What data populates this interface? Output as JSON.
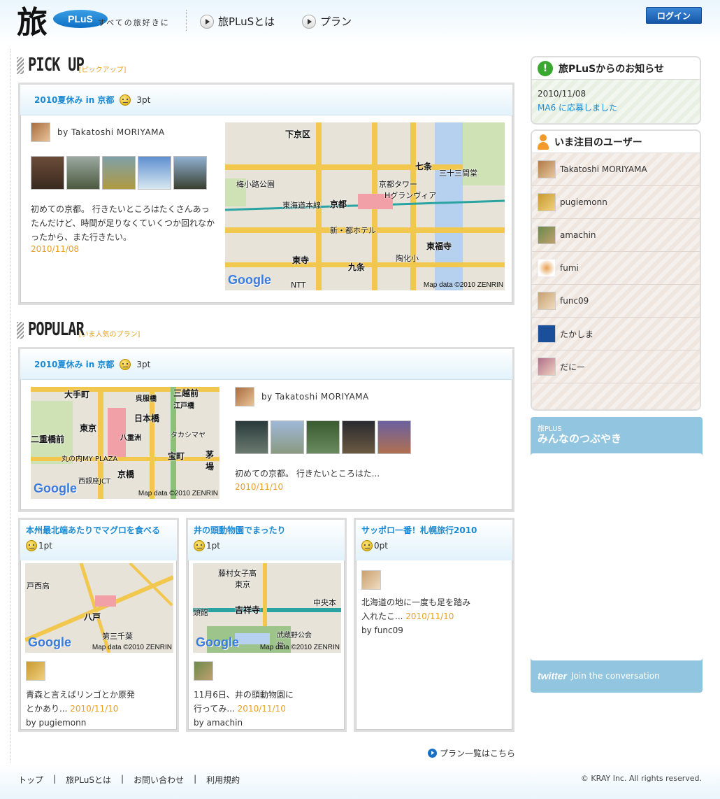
{
  "header": {
    "logo_kanji": "旅",
    "logo_badge": "PLuS",
    "tagline": "すべての旅好きに",
    "nav": [
      {
        "label": "旅PLuSとは"
      },
      {
        "label": "プラン"
      }
    ],
    "login_label": "ログイン"
  },
  "pickup": {
    "heading": "PICK UP",
    "subheading": "[ピックアップ]",
    "plan_title": "2010夏休み in 京都",
    "points": "3pt",
    "author": "by Takatoshi MORIYAMA",
    "description": "初めての京都。 行きたいところはたくさんあったんだけど、時間が足りなくていくつか回れなかったから、また行きたい。",
    "date": "2010/11/08",
    "map": {
      "credit": "Map data ©2010 ZENRIN",
      "powered": "Google",
      "labels": [
        "下京区",
        "七条",
        "京都",
        "東寺",
        "東福寺",
        "九条",
        "東海道本線",
        "梅小路公園",
        "京都タワー",
        "新・都ホテル",
        "三十三間堂",
        "Hグランヴィア",
        "NTT",
        "陶化小"
      ]
    }
  },
  "popular": {
    "heading": "POPULAR",
    "subheading": "[いま人気のプラン]",
    "plan_title": "2010夏休み in 京都",
    "points": "3pt",
    "author": "by Takatoshi MORIYAMA",
    "description": "初めての京都。 行きたいところはた...",
    "date": "2010/11/10",
    "map": {
      "credit": "Map data ©2010 ZENRIN",
      "powered": "Google",
      "labels": [
        "大手町",
        "三越前",
        "日本橋",
        "東京",
        "二重橋前",
        "八重洲",
        "京橋",
        "宝町",
        "茅場",
        "丸の内MY PLAZA",
        "西銀座JCT",
        "呉服橋",
        "江戸橋",
        "タカシマヤ"
      ]
    }
  },
  "cards": [
    {
      "title": "本州最北端あたりでマグロを食べる",
      "points": "1pt",
      "description_1": "青森と言えばリンゴとか原発",
      "description_2": "とかあり...",
      "date": "2010/11/10",
      "author": "by pugiemonn",
      "map": {
        "credit": "Map data ©2010 ZENRIN",
        "powered": "Google",
        "labels": [
          "八戸",
          "戸西高",
          "第三千葉"
        ]
      }
    },
    {
      "title": "井の頭動物園でまったり",
      "points": "1pt",
      "description_1": "11月6日、井の頭動物園に",
      "description_2": "行ってみ...",
      "date": "2010/11/10",
      "author": "by amachin",
      "map": {
        "credit": "Map data ©2010 ZENRIN",
        "powered": "Google",
        "labels": [
          "吉祥寺",
          "藤村女子高",
          "東京",
          "頭館",
          "中央本",
          "武蔵野公会堂"
        ]
      }
    },
    {
      "title": "サッポロ一番！札幌旅行2010",
      "points": "0pt",
      "description_1": "北海道の地に一度も足を踏み",
      "description_2": "入れたこ...",
      "date": "2010/11/10",
      "author": "by func09"
    }
  ],
  "more_link": "プラン一覧はこちら",
  "notice": {
    "title": "旅PLuSからのお知らせ",
    "date": "2010/11/08",
    "text": "MA6 に応募しました"
  },
  "users": {
    "title": "いま注目のユーザー",
    "items": [
      {
        "name": "Takatoshi MORIYAMA",
        "color": "#b07a48"
      },
      {
        "name": "pugiemonn",
        "color": "#c89a30"
      },
      {
        "name": "amachin",
        "color": "#6b8a4a"
      },
      {
        "name": "fumi",
        "color": "#e8a050"
      },
      {
        "name": "func09",
        "color": "#c8a070"
      },
      {
        "name": "たかしま",
        "color": "#1a4f9a"
      },
      {
        "name": "だにー",
        "color": "#b0708a"
      }
    ]
  },
  "twitter": {
    "small_title": "旅PLUS",
    "big_title": "みんなのつぶやき",
    "logo": "twitter",
    "join": "Join the conversation"
  },
  "footer": {
    "links": [
      "トップ",
      "旅PLuSとは",
      "お問い合わせ",
      "利用規約"
    ],
    "separator": "|",
    "copyright": "© KRAY Inc. All rights reserved."
  },
  "colors": {
    "link_blue": "#1a8ad4",
    "date_orange": "#e8a020",
    "login_blue": "#1557a8",
    "twitter_panel": "#91c5e0"
  }
}
